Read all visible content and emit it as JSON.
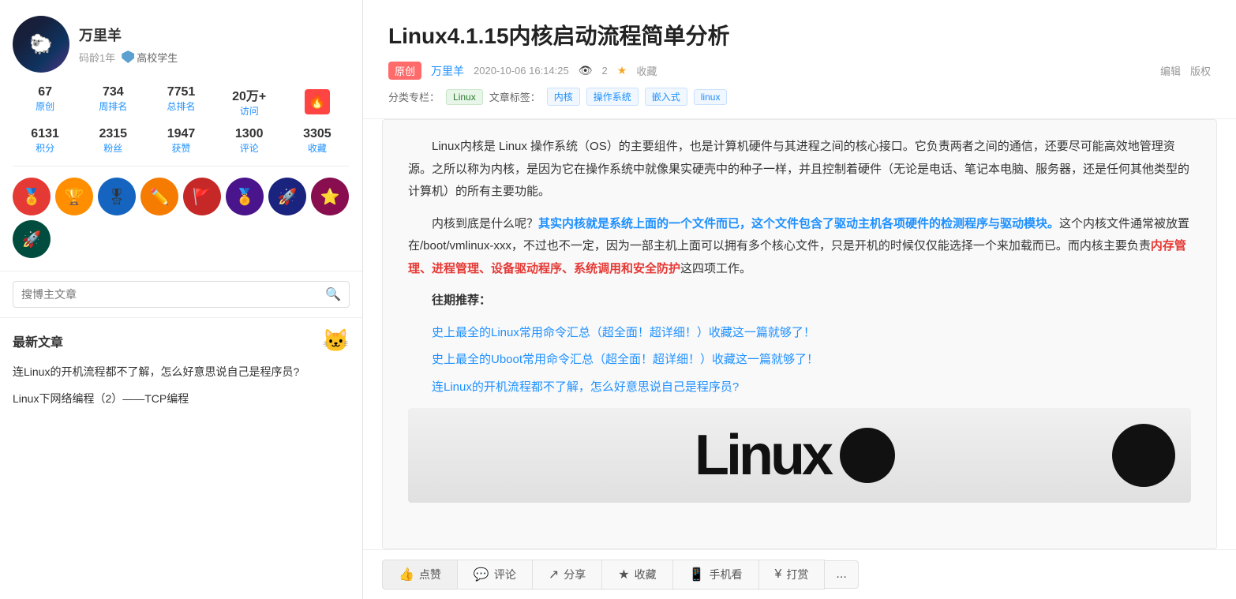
{
  "sidebar": {
    "profile": {
      "name": "万里羊",
      "age_label": "码龄1年",
      "role": "高校学生"
    },
    "stats1": [
      {
        "value": "67",
        "label": "原创"
      },
      {
        "value": "734",
        "label": "周排名"
      },
      {
        "value": "7751",
        "label": "总排名"
      },
      {
        "value": "20万+",
        "label": "访问"
      },
      {
        "value": "等级",
        "label": "等级",
        "is_icon": true
      }
    ],
    "stats2": [
      {
        "value": "6131",
        "label": "积分"
      },
      {
        "value": "2315",
        "label": "粉丝"
      },
      {
        "value": "1947",
        "label": "获赞"
      },
      {
        "value": "1300",
        "label": "评论"
      },
      {
        "value": "3305",
        "label": "收藏"
      }
    ],
    "search": {
      "placeholder": "搜博主文章",
      "button_label": "🔍"
    },
    "latest": {
      "title": "最新文章",
      "articles": [
        {
          "text": "连Linux的开机流程都不了解，怎么好意思说自己是程序员?"
        },
        {
          "text": "Linux下网络编程（2）——TCP编程"
        }
      ]
    }
  },
  "article": {
    "title": "Linux4.1.15内核启动流程简单分析",
    "original_badge": "原创",
    "author": "万里羊",
    "date": "2020-10-06 16:14:25",
    "views": "2",
    "collect_label": "收藏",
    "edit_label": "编辑",
    "rights_label": "版权",
    "category_label": "分类专栏：",
    "category": "Linux",
    "tags_label": "文章标签：",
    "tags": [
      "内核",
      "操作系统",
      "嵌入式",
      "linux"
    ],
    "body": {
      "para1": "Linux内核是 Linux 操作系统（OS）的主要组件，也是计算机硬件与其进程之间的核心接口。它负责两者之间的通信，还要尽可能高效地管理资源。之所以称为内核，是因为它在操作系统中就像果实硬壳中的种子一样，并且控制着硬件（无论是电话、笔记本电脑、服务器，还是任何其他类型的计算机）的所有主要功能。",
      "para2_prefix": "内核到底是什么呢？",
      "para2_highlight": "其实内核就是系统上面的一个文件而已，这个文件包含了驱动主机各项硬件的检测程序与驱动模块。",
      "para2_suffix": "这个内核文件通常被放置在/boot/vmlinux-xxx，不过也不一定，因为一部主机上面可以拥有多个核心文件，只是开机的时候仅仅能选择一个来加载而已。而内核主要负责",
      "para2_highlight2": "内存管理、进程管理、设备驱动程序、系统调用和安全防护",
      "para2_suffix2": "这四项工作。",
      "recommend_title": "往期推荐：",
      "links": [
        "史上最全的Linux常用命令汇总（超全面！超详细！）收藏这一篇就够了！",
        "史上最全的Uboot常用命令汇总（超全面！超详细！）收藏这一篇就够了！",
        "连Linux的开机流程都不了解，怎么好意思说自己是程序员?"
      ]
    },
    "actions": [
      {
        "icon": "👍",
        "label": "点赞"
      },
      {
        "icon": "💬",
        "label": "评论"
      },
      {
        "icon": "↗",
        "label": "分享"
      },
      {
        "icon": "★",
        "label": "收藏"
      },
      {
        "icon": "📱",
        "label": "手机看"
      },
      {
        "icon": "¥",
        "label": "打赏"
      }
    ],
    "more_label": "..."
  }
}
